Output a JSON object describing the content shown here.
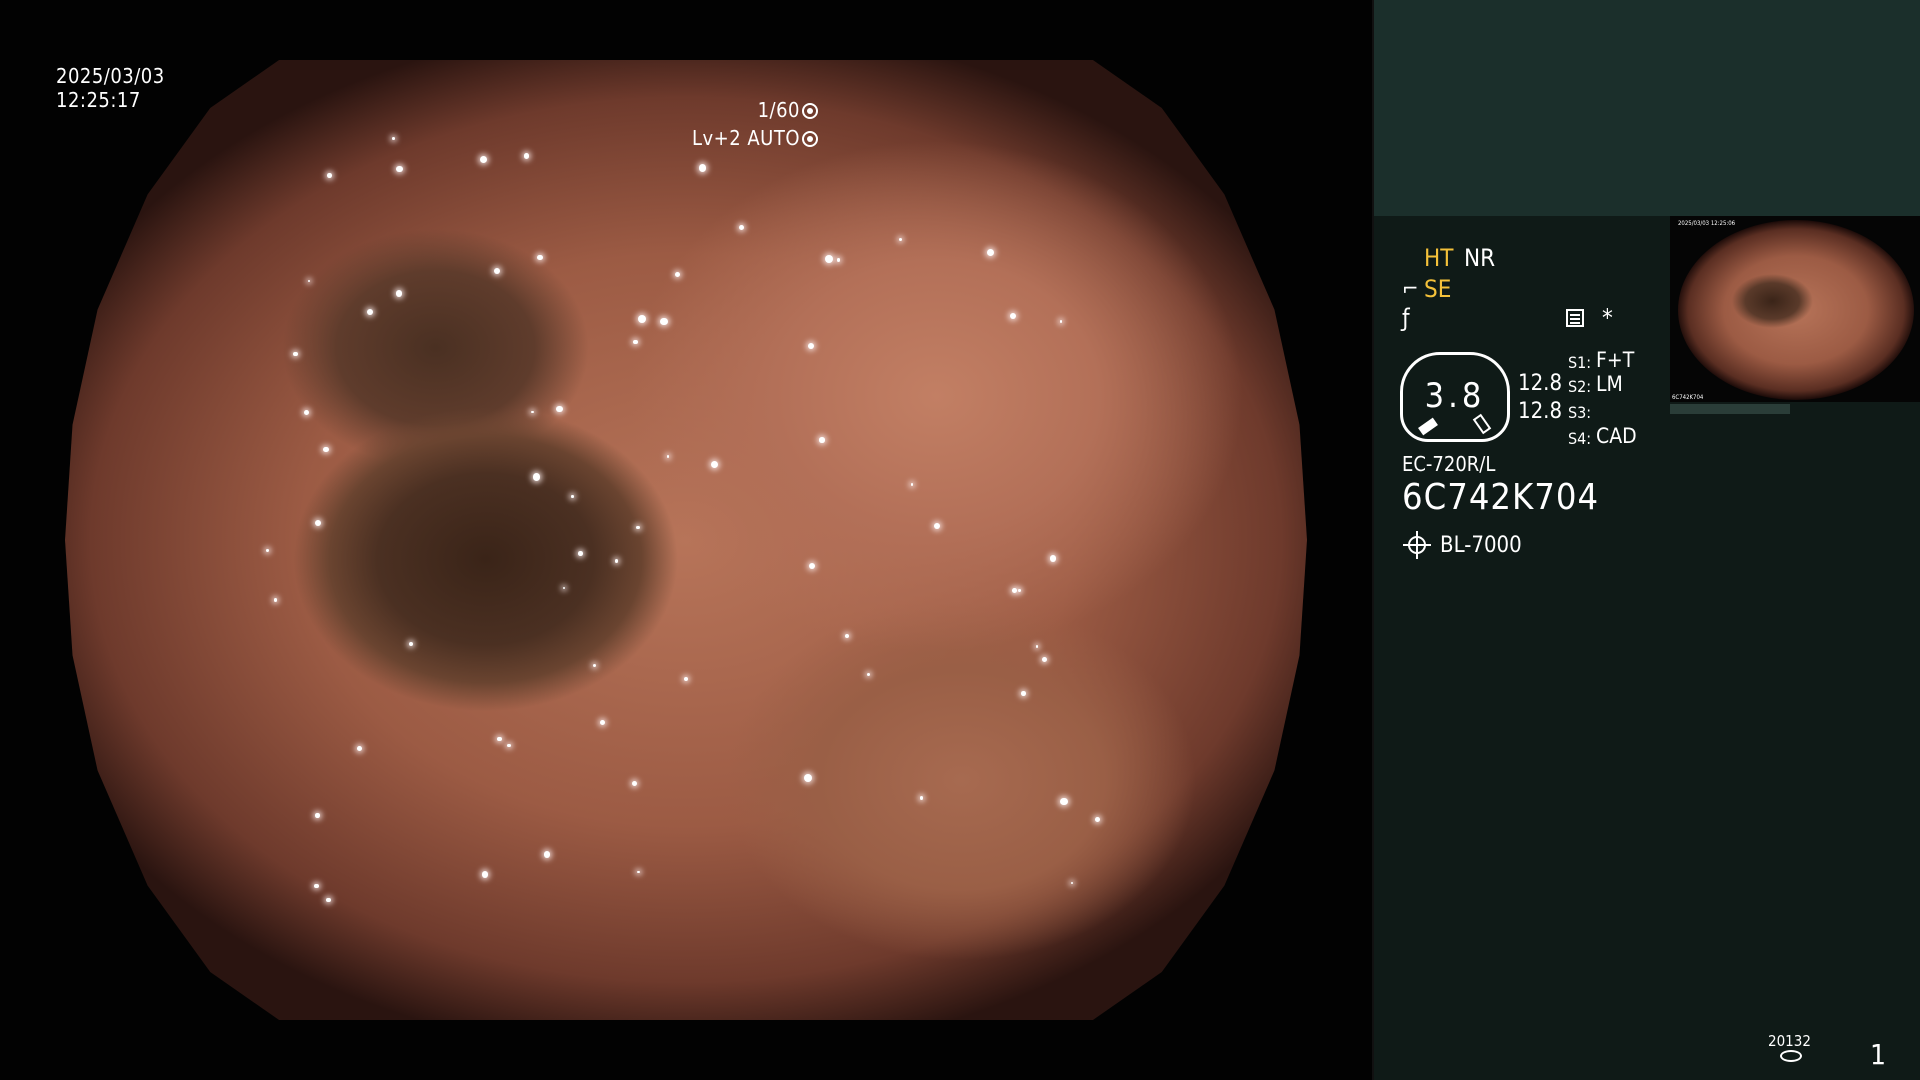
{
  "scope": {
    "date": "2025/03/03",
    "time": "12:25:17",
    "shutter": "1/60",
    "exposure": "Lv+2 AUTO"
  },
  "panel": {
    "ht": "HT",
    "nr": "NR",
    "se": "SE",
    "se_icon": "scope-bend-icon",
    "f_icon": "f-hook-icon",
    "asterisk": "*",
    "octagon_value": "3.8",
    "value_1": "12.8",
    "value_2": "12.8",
    "s_labels": [
      "S1:",
      "S2:",
      "S3:",
      "S4:"
    ],
    "s_values": [
      "F+T",
      "LM",
      "",
      "CAD"
    ],
    "model": "EC-720R/L",
    "serial": "6C742K704",
    "light_model": "BL-7000",
    "counter": "20132",
    "page": "1"
  },
  "thumbnail": {
    "date": "2025/03/03 12:25:06",
    "serial": "6C742K704"
  },
  "colors": {
    "accent_yellow": "#f4c13a",
    "panel_bg": "#0f1a17",
    "panel_top_bg": "#1b2f2b"
  }
}
